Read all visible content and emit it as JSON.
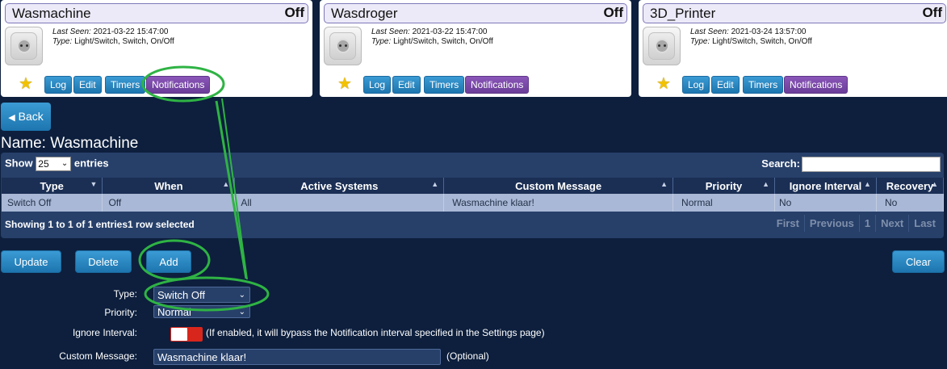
{
  "devices": [
    {
      "name": "Wasmachine",
      "state": "Off",
      "last_seen_label": "Last Seen:",
      "last_seen": "2021-03-22 15:47:00",
      "type_label": "Type:",
      "type": "Light/Switch, Switch, On/Off"
    },
    {
      "name": "Wasdroger",
      "state": "Off",
      "last_seen_label": "Last Seen:",
      "last_seen": "2021-03-22 15:47:00",
      "type_label": "Type:",
      "type": "Light/Switch, Switch, On/Off"
    },
    {
      "name": "3D_Printer",
      "state": "Off",
      "last_seen_label": "Last Seen:",
      "last_seen": "2021-03-24 13:57:00",
      "type_label": "Type:",
      "type": "Light/Switch, Switch, On/Off"
    }
  ],
  "card_buttons": {
    "log": "Log",
    "edit": "Edit",
    "timers": "Timers",
    "notifications": "Notifications"
  },
  "icons": {
    "favorite": "star-icon",
    "device": "socket-icon",
    "back": "caret-left-icon"
  },
  "colors": {
    "accent_blue": "#1d75ae",
    "accent_purple": "#6b3d98",
    "highlight_green": "#2fb344",
    "toggle_red": "#d9261c"
  },
  "back_label": "Back",
  "page_title": "Name: Wasmachine",
  "table": {
    "show_label": "Show",
    "entries_label": "entries",
    "page_length": "25",
    "search_label": "Search:",
    "columns": [
      "Type",
      "When",
      "Active Systems",
      "Custom Message",
      "Priority",
      "Ignore Interval",
      "Recovery"
    ],
    "rows": [
      [
        "Switch Off",
        "Off",
        "All",
        "Wasmachine klaar!",
        "Normal",
        "No",
        "No"
      ]
    ],
    "info": "Showing 1 to 1 of 1 entries1 row selected",
    "pager": {
      "first": "First",
      "previous": "Previous",
      "page": "1",
      "next": "Next",
      "last": "Last"
    }
  },
  "actions": {
    "update": "Update",
    "delete": "Delete",
    "add": "Add",
    "clear": "Clear"
  },
  "form": {
    "type_label": "Type:",
    "type_value": "Switch Off",
    "priority_label": "Priority:",
    "priority_value": "Normal",
    "ignore_label": "Ignore Interval:",
    "ignore_hint": "(If enabled, it will bypass the Notification interval specified in the Settings page)",
    "message_label": "Custom Message:",
    "message_value": "Wasmachine klaar!",
    "message_hint": "(Optional)"
  }
}
